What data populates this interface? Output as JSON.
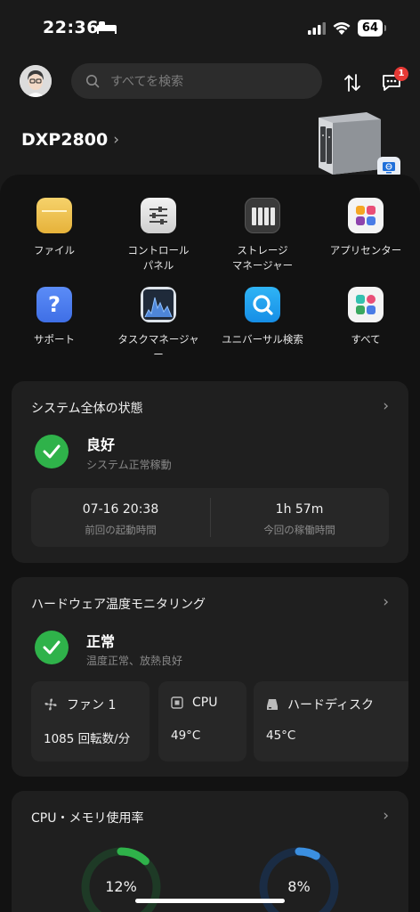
{
  "status_bar": {
    "time": "22:36",
    "battery": "64"
  },
  "search": {
    "placeholder": "すべてを検索"
  },
  "notifications": {
    "badge": "1"
  },
  "device": {
    "name": "DXP2800"
  },
  "apps": [
    {
      "label": "ファイル",
      "icon": "folder-icon"
    },
    {
      "label": "コントロール\nパネル",
      "icon": "sliders-icon"
    },
    {
      "label": "ストレージ\nマネージャー",
      "icon": "storage-icon"
    },
    {
      "label": "アプリセンター",
      "icon": "app-center-icon"
    },
    {
      "label": "サポート",
      "icon": "help-icon"
    },
    {
      "label": "タスクマネージャ\nー",
      "icon": "task-manager-icon"
    },
    {
      "label": "ユニバーサル検索",
      "icon": "universal-search-icon"
    },
    {
      "label": "すべて",
      "icon": "all-apps-icon"
    }
  ],
  "system_card": {
    "title": "システム全体の状態",
    "status": "良好",
    "status_sub": "システム正常稼動",
    "boot_time": "07-16 20:38",
    "boot_time_label": "前回の起動時間",
    "uptime": "1h 57m",
    "uptime_label": "今回の稼働時間"
  },
  "hardware_card": {
    "title": "ハードウェア温度モニタリング",
    "status": "正常",
    "status_sub": "温度正常、放熱良好",
    "fan_label": "ファン 1",
    "fan_value": "1085 回転数/分",
    "cpu_label": "CPU",
    "cpu_value": "49°C",
    "disk_label": "ハードディスク",
    "disk_value": "45°C"
  },
  "usage_card": {
    "title": "CPU・メモリ使用率",
    "cpu_usage": "12%",
    "cpu_fraction": 0.12,
    "mem_usage": "8%",
    "mem_fraction": 0.08
  },
  "colors": {
    "ok_green": "#2fb24a",
    "cpu_ring": "#2fb24a",
    "mem_ring": "#3b8fe0",
    "badge_red": "#e53935"
  }
}
